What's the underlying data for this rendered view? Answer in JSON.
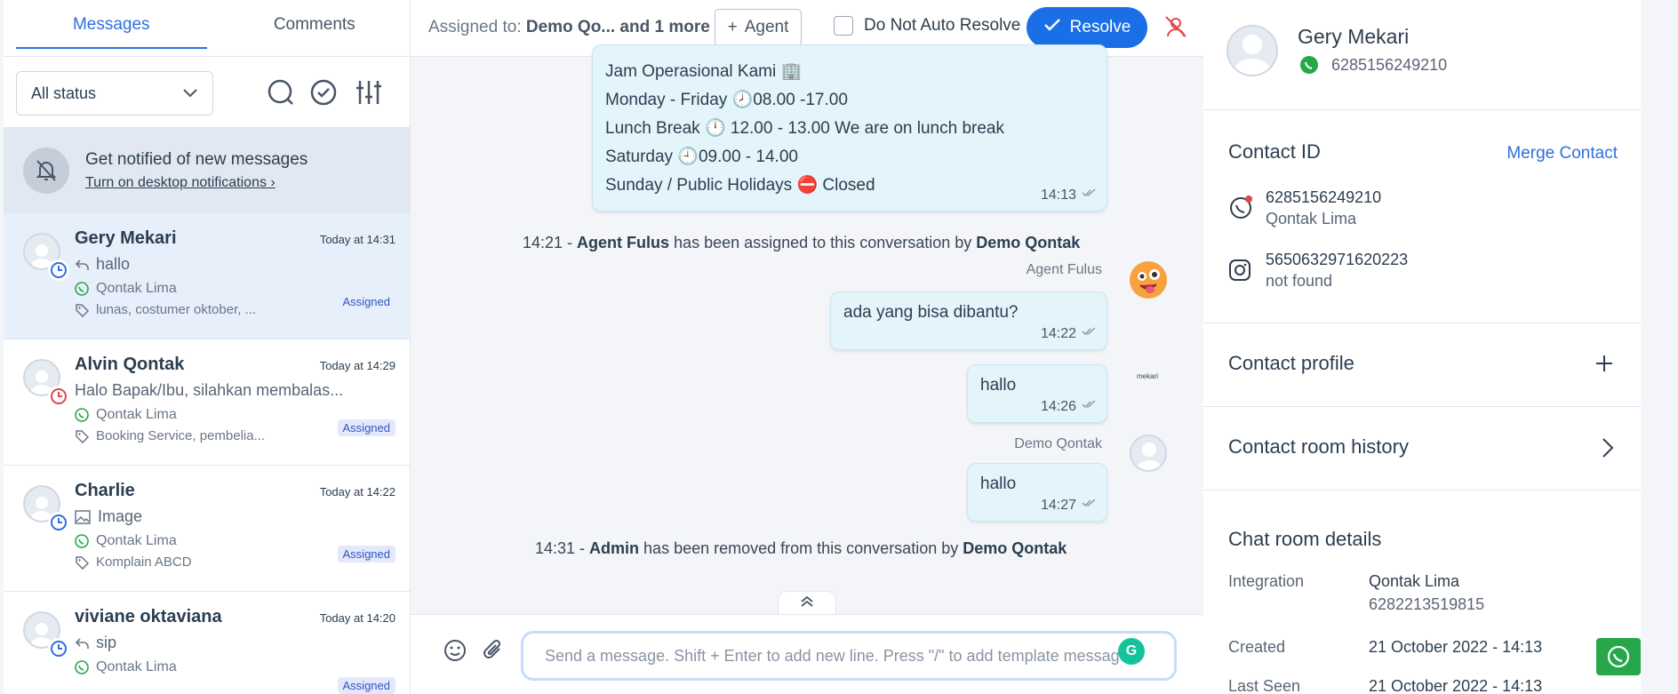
{
  "left": {
    "tabs": [
      {
        "label": "Messages"
      },
      {
        "label": "Comments"
      }
    ],
    "status_filter": "All status",
    "notify": {
      "title": "Get notified of new messages",
      "link": "Turn on desktop notifications"
    },
    "conversations": [
      {
        "name": "Gery Mekari",
        "time": "Today at 14:31",
        "preview": "hallo",
        "inbox": "Qontak Lima",
        "tags": "lunas, costumer oktober, ...",
        "status": "Assigned",
        "clock_color": "#2f6fe0"
      },
      {
        "name": "Alvin Qontak",
        "time": "Today at 14:29",
        "preview": "Halo Bapak/Ibu, silahkan membalas...",
        "inbox": "Qontak Lima",
        "tags": "Booking Service, pembelia...",
        "status": "Assigned",
        "clock_color": "#e04848"
      },
      {
        "name": "Charlie",
        "time": "Today at 14:22",
        "preview": "Image",
        "inbox": "Qontak Lima",
        "tags": "Komplain ABCD",
        "status": "Assigned",
        "clock_color": "#2f6fe0"
      },
      {
        "name": "viviane oktaviana",
        "time": "Today at 14:20",
        "preview": "sip",
        "inbox": "Qontak Lima",
        "tags": "",
        "status": "Assigned",
        "clock_color": "#2f6fe0"
      }
    ]
  },
  "chat": {
    "header": {
      "assigned_label": "Assigned to:",
      "assigned_value": "Demo Qo... and 1 more",
      "agent_button": "Agent",
      "do_not_auto_resolve": "Do Not Auto Resolve",
      "resolve_button": "Resolve"
    },
    "hours_bubble": {
      "line1": "Jam Operasional Kami 🏢",
      "line2": "Monday - Friday 🕗08.00 -17.00",
      "line3": "Lunch Break 🕛 12.00 - 13.00 We are on lunch break",
      "line4": "Saturday 🕘09.00 - 14.00",
      "line5": "Sunday / Public Holidays ⛔ Closed",
      "time": "14:13"
    },
    "system1": {
      "time": "14:21 - ",
      "actor": "Agent Fulus",
      "text": " has been assigned to this conversation by ",
      "by": "Demo Qontak"
    },
    "sender1": "Agent Fulus",
    "msg1": {
      "text": "ada yang bisa dibantu?",
      "time": "14:22"
    },
    "msg2": {
      "text": "hallo",
      "time": "14:26"
    },
    "avatar2_label": "mekari",
    "sender3": "Demo Qontak",
    "msg3": {
      "text": "hallo",
      "time": "14:27"
    },
    "system2": {
      "time": "14:31 - ",
      "actor": "Admin",
      "text": " has been removed from this conversation by ",
      "by": "Demo Qontak"
    },
    "composer_placeholder": "Send a message. Shift + Enter to add new line. Press \"/\" to add template messages"
  },
  "right": {
    "contact_name": "Gery Mekari",
    "contact_phone": "6285156249210",
    "contact_id_title": "Contact ID",
    "merge_contact": "Merge Contact",
    "wa_id": "6285156249210",
    "wa_inbox": "Qontak Lima",
    "ig_id": "5650632971620223",
    "ig_status": "not found",
    "contact_profile": "Contact profile",
    "contact_room_history": "Contact room history",
    "chat_room_details": "Chat room details",
    "details": [
      {
        "label": "Integration",
        "value": "Qontak Lima",
        "sub": "6282213519815"
      },
      {
        "label": "Created",
        "value": "21 October 2022 - 14:13",
        "sub": ""
      },
      {
        "label": "Last Seen",
        "value": "21 October 2022 - 14:13",
        "sub": ""
      }
    ]
  },
  "colors": {
    "primary": "#1a6fe6",
    "whatsapp": "#27a74a",
    "danger": "#e04848"
  }
}
